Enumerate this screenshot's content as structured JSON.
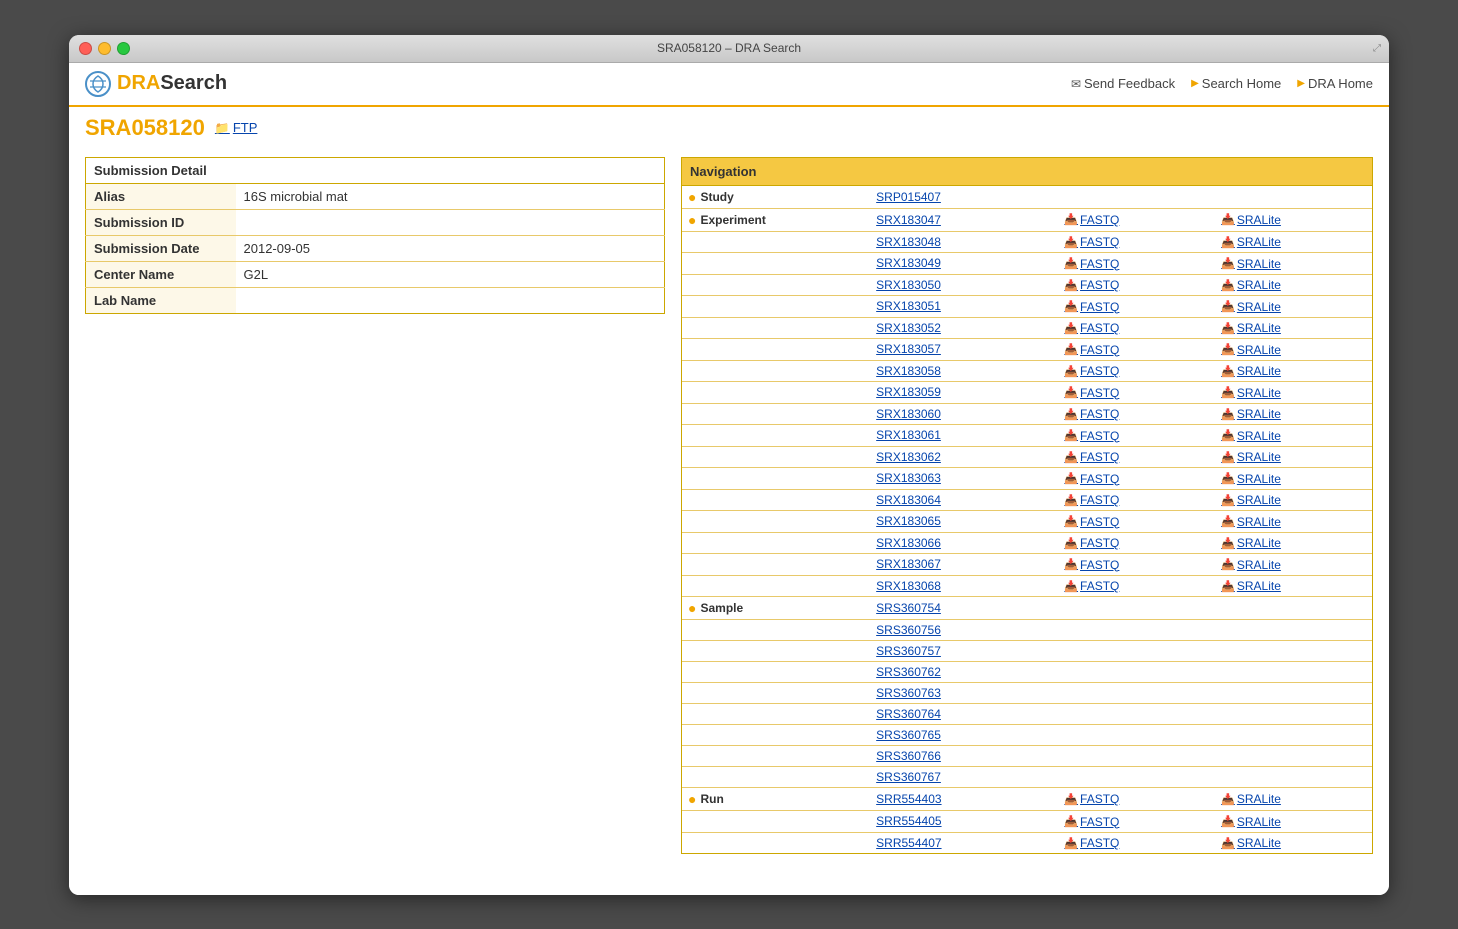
{
  "window": {
    "title": "SRA058120 – DRA Search"
  },
  "header": {
    "logo_text_accent": "DRA",
    "logo_text_rest": "Search",
    "nav_items": [
      {
        "label": "Send Feedback",
        "icon": "envelope",
        "name": "send-feedback-link"
      },
      {
        "label": "Search Home",
        "icon": "arrow",
        "name": "search-home-link"
      },
      {
        "label": "DRA Home",
        "icon": "arrow",
        "name": "dra-home-link"
      }
    ]
  },
  "page": {
    "id": "SRA058120",
    "ftp_label": "FTP"
  },
  "submission_detail": {
    "header": "Submission Detail",
    "fields": [
      {
        "label": "Alias",
        "value": "16S microbial mat"
      },
      {
        "label": "Submission ID",
        "value": ""
      },
      {
        "label": "Submission Date",
        "value": "2012-09-05"
      },
      {
        "label": "Center Name",
        "value": "G2L"
      },
      {
        "label": "Lab Name",
        "value": ""
      }
    ]
  },
  "navigation": {
    "header": "Navigation",
    "categories": [
      {
        "name": "Study",
        "items": [
          {
            "id": "SRP015407",
            "fastq": null,
            "sralite": null
          }
        ]
      },
      {
        "name": "Experiment",
        "items": [
          {
            "id": "SRX183047",
            "fastq": "FASTQ",
            "sralite": "SRALite"
          },
          {
            "id": "SRX183048",
            "fastq": "FASTQ",
            "sralite": "SRALite"
          },
          {
            "id": "SRX183049",
            "fastq": "FASTQ",
            "sralite": "SRALite"
          },
          {
            "id": "SRX183050",
            "fastq": "FASTQ",
            "sralite": "SRALite"
          },
          {
            "id": "SRX183051",
            "fastq": "FASTQ",
            "sralite": "SRALite"
          },
          {
            "id": "SRX183052",
            "fastq": "FASTQ",
            "sralite": "SRALite"
          },
          {
            "id": "SRX183057",
            "fastq": "FASTQ",
            "sralite": "SRALite"
          },
          {
            "id": "SRX183058",
            "fastq": "FASTQ",
            "sralite": "SRALite"
          },
          {
            "id": "SRX183059",
            "fastq": "FASTQ",
            "sralite": "SRALite"
          },
          {
            "id": "SRX183060",
            "fastq": "FASTQ",
            "sralite": "SRALite"
          },
          {
            "id": "SRX183061",
            "fastq": "FASTQ",
            "sralite": "SRALite"
          },
          {
            "id": "SRX183062",
            "fastq": "FASTQ",
            "sralite": "SRALite"
          },
          {
            "id": "SRX183063",
            "fastq": "FASTQ",
            "sralite": "SRALite"
          },
          {
            "id": "SRX183064",
            "fastq": "FASTQ",
            "sralite": "SRALite"
          },
          {
            "id": "SRX183065",
            "fastq": "FASTQ",
            "sralite": "SRALite"
          },
          {
            "id": "SRX183066",
            "fastq": "FASTQ",
            "sralite": "SRALite"
          },
          {
            "id": "SRX183067",
            "fastq": "FASTQ",
            "sralite": "SRALite"
          },
          {
            "id": "SRX183068",
            "fastq": "FASTQ",
            "sralite": "SRALite"
          }
        ]
      },
      {
        "name": "Sample",
        "items": [
          {
            "id": "SRS360754",
            "fastq": null,
            "sralite": null
          },
          {
            "id": "SRS360756",
            "fastq": null,
            "sralite": null
          },
          {
            "id": "SRS360757",
            "fastq": null,
            "sralite": null
          },
          {
            "id": "SRS360762",
            "fastq": null,
            "sralite": null
          },
          {
            "id": "SRS360763",
            "fastq": null,
            "sralite": null
          },
          {
            "id": "SRS360764",
            "fastq": null,
            "sralite": null
          },
          {
            "id": "SRS360765",
            "fastq": null,
            "sralite": null
          },
          {
            "id": "SRS360766",
            "fastq": null,
            "sralite": null
          },
          {
            "id": "SRS360767",
            "fastq": null,
            "sralite": null
          }
        ]
      },
      {
        "name": "Run",
        "items": [
          {
            "id": "SRR554403",
            "fastq": "FASTQ",
            "sralite": "SRALite"
          },
          {
            "id": "SRR554405",
            "fastq": "FASTQ",
            "sralite": "SRALite"
          },
          {
            "id": "SRR554407",
            "fastq": "FASTQ",
            "sralite": "SRALite"
          }
        ]
      }
    ]
  }
}
